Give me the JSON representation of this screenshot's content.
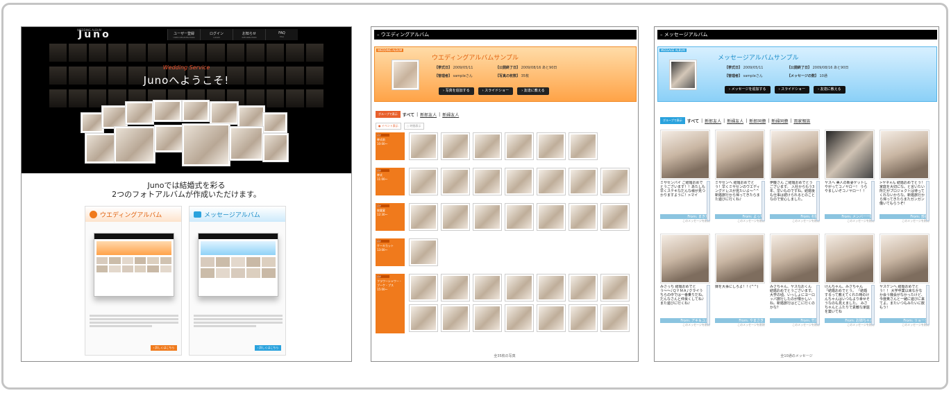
{
  "panel1": {
    "logo": "Juno",
    "logo_sub": "WEDDING ALBUM",
    "nav": [
      {
        "label": "ユーザー登録",
        "sub": "USER REGISTRATION"
      },
      {
        "label": "ログイン",
        "sub": "LOGIN"
      },
      {
        "label": "お知らせ",
        "sub": "INFORMATION"
      },
      {
        "label": "FAQ",
        "sub": "FAQ"
      }
    ],
    "hero_tagline": "Wedding Service",
    "hero_welcome": "Junoへようこそ!",
    "headline1": "Junoでは結婚式を彩る",
    "headline2": "2つのフォトアルバムが作成いただけます。",
    "cards": [
      {
        "title": "ウエディングアルバム",
        "accent": "#f07a1c",
        "more": "› 詳しくはこちら"
      },
      {
        "title": "メッセージアルバム",
        "accent": "#2aa2dd",
        "more": "› 詳しくはこちら"
      }
    ]
  },
  "panel2": {
    "bar_title": "– ウエディングアルバム",
    "tag": "WEDDING ALBUM",
    "album_title": "ウエディングアルバムサンプル",
    "info": {
      "ceremony_label": "【挙式日】",
      "ceremony_value": "2009/05/11",
      "end_label": "【公開終了日】",
      "end_value": "2009/08/16 あと90日",
      "admin_label": "【管理者】",
      "admin_value": "sampleさん",
      "count_label": "【写真の枚数】",
      "count_value": "35枚"
    },
    "buttons": [
      "› 写真を追加する",
      "› スライドショー",
      "› 友達に教える"
    ],
    "group_label": "グループで表示",
    "tabs": [
      "すべて",
      "新郎友人",
      "新婦友人"
    ],
    "toggles": [
      "● イベント表示",
      "○ 時間表示"
    ],
    "events": [
      {
        "badge": "ほか",
        "name": "挙式前",
        "time": "10:00〜"
      },
      {
        "badge": "ほか",
        "name": "挙式",
        "time": "11:00〜"
      },
      {
        "badge": "ほか",
        "name": "披露宴",
        "time": "12:30〜"
      },
      {
        "badge": "ほか",
        "name": "ケーキカット",
        "time": "13:00〜"
      },
      {
        "badge": "ほか",
        "name": "フラワーシャワー・ブーケ・プス",
        "time": "15:00〜"
      }
    ],
    "footer": "全35枚の写真"
  },
  "panel3": {
    "bar_title": "– メッセージアルバム",
    "tag": "MESSAGE ALBUM",
    "album_title": "メッセージアルバムサンプル",
    "info": {
      "ceremony_label": "【挙式日】",
      "ceremony_value": "2009/05/11",
      "end_label": "【公開終了日】",
      "end_value": "2009/08/16 あと90日",
      "admin_label": "【管理者】",
      "admin_value": "sampleさん",
      "count_label": "【メッセージの数】",
      "count_value": "10通"
    },
    "buttons": [
      "› メッセージを追加する",
      "› スライドショー",
      "› 友達に教える"
    ],
    "group_label": "グループで表示",
    "tabs": [
      "すべて",
      "新郎友人",
      "新婦友人",
      "新郎同僚",
      "新婦同僚",
      "両家親族"
    ],
    "messages": [
      {
        "text": "ミサセンパイ ご結婚おめでとうございます！！あたしも早くステキなだんな様が見つかりますように！>マイ",
        "from": "From: まきた",
        "link": "このメッセージを削除"
      },
      {
        "text": "ミサセンへ 結婚おめでとう！早くミサセンのウエディングドレスが見たいよ〜^^ 新婚旅行から帰ってきたらまた遊びに行くね♪",
        "from": "From: よっち",
        "link": "このメッセージを削除"
      },
      {
        "text": "伊藤さん ご結婚おめでとうございます。 入社からもう3年、早いものですね。結婚後も仕事は続けられるとのことなので安心しました。",
        "from": "From: 杉野",
        "link": "このメッセージを削除"
      },
      {
        "text": "ヤスへ 美人の新妻ゲットしやがってコノヤロー！ うらやましいぞコノヤロー！！",
        "from": "From: メンバー一同",
        "link": "このメッセージを削除"
      },
      {
        "text": ">ヤネ×ん 結婚おめでとう！家庭を大切にな。と言いたい所だがプロジェクトは待ってくれないからな。新婚旅行から帰ってきたらまたガンガン働いてもらうぞ！",
        "from": "From: 部長",
        "link": "このメッセージを削除"
      },
      {
        "text": "みさっち 結婚おめでとう〜〜♪ＱＹＭＡ♪クライうちらの中では一番乗りだね。だんなさんと仲良くしてね♪ また遊びに行くね♪",
        "from": "From: アキ＆ユカ",
        "link": "このメッセージを削除"
      },
      {
        "text": "嫁を大事にしろよ！！(^^)",
        "from": "From: やまさき",
        "link": "このメッセージを削除"
      },
      {
        "text": "みさちゃん、ヤスなおくん 結婚おめでとうございます。 大学の頃、いっしょにヨーロッパ旅行したのが懐かしいね。新婚旅行はどこに行くのかな？",
        "from": "From: 竹本",
        "link": "このメッセージを削除"
      },
      {
        "text": "けんちゃん、みさちゃん 「結婚おめでとう。 「結婚するって教えてくれた時のけんちゃんはいつもより幸せそうなのも見えました。 みさちゃんとふたりで素敵な家庭を築いてね",
        "from": "From: お姉ちゃん",
        "link": "このメッセージを削除"
      },
      {
        "text": "ヤスケンへ 結婚おめでとう！！ 大学卒業以来なかなか会う機会がなかったけど、今度奥さんと一緒に遊びに来てよ。またいつもみたいに飲もう！",
        "from": "From: リョータ",
        "link": "このメッセージを削除"
      }
    ],
    "footer": "全10通のメッセージ"
  },
  "colors": {
    "orange": "#f07a1c",
    "blue": "#2aa2dd",
    "frame": "#c4c4c4"
  }
}
